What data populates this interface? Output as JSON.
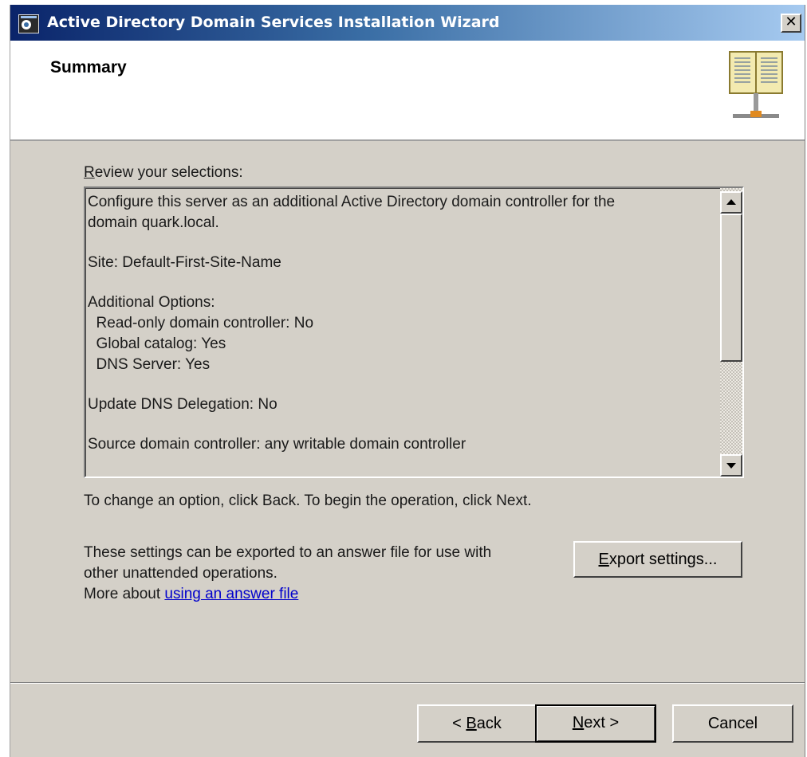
{
  "window": {
    "title": "Active Directory Domain Services Installation Wizard",
    "close_glyph": "✕"
  },
  "header": {
    "title": "Summary"
  },
  "review": {
    "label_accel": "R",
    "label_rest": "eview your selections:",
    "lines": [
      "Configure this server as an additional Active Directory domain controller for the",
      "domain quark.local.",
      "",
      "Site: Default-First-Site-Name",
      "",
      "Additional Options:",
      "  Read-only domain controller: No",
      "  Global catalog: Yes",
      "  DNS Server: Yes",
      "",
      "Update DNS Delegation: No",
      "",
      "Source domain controller: any writable domain controller"
    ]
  },
  "change_text": "To change an option, click Back. To begin the operation, click Next.",
  "export": {
    "line1": "These settings can be exported to an answer file for use with",
    "line2": "other unattended operations.",
    "more_prefix": "More about ",
    "more_link": "using an answer file",
    "button_accel": "E",
    "button_rest": "xport settings..."
  },
  "buttons": {
    "back_prefix": "< ",
    "back_accel": "B",
    "back_rest": "ack",
    "next_accel": "N",
    "next_rest": "ext >",
    "cancel": "Cancel"
  }
}
